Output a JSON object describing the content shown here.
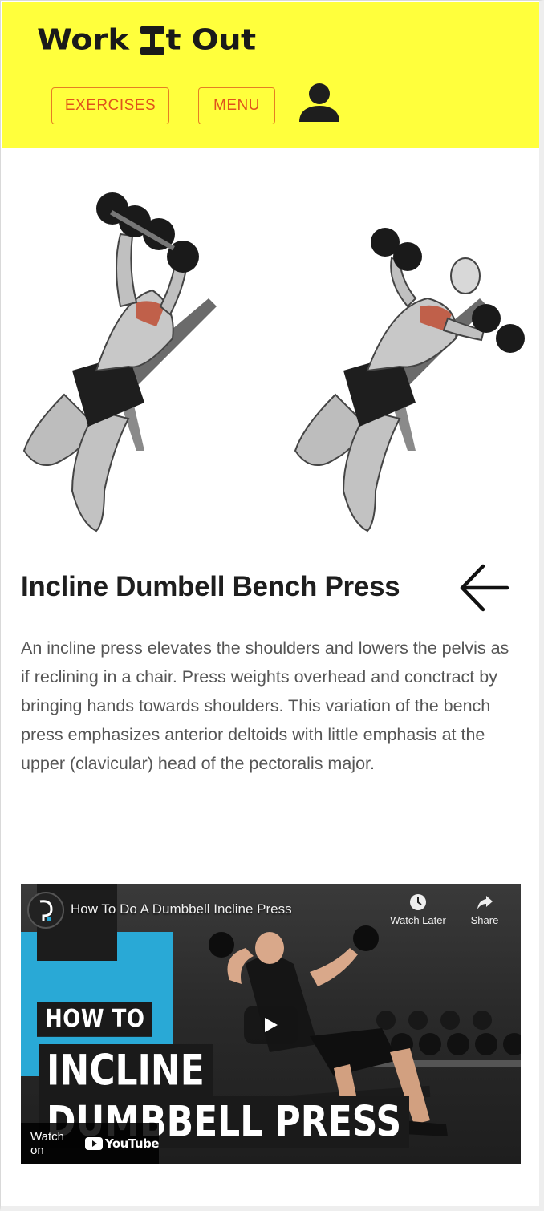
{
  "header": {
    "logo_word_1": "Work",
    "logo_word_2": "t Out",
    "nav": {
      "exercises_label": "EXERCISES",
      "menu_label": "MENU"
    },
    "colors": {
      "background": "#ffff3c",
      "button_text": "#e0531b",
      "button_border": "#e67e22"
    }
  },
  "exercise": {
    "title": "Incline Dumbell Bench Press",
    "description": "An incline press elevates the shoulders and lowers the pelvis as if reclining in a chair. Press weights overhead and conctract by bringing hands towards shoulders. This variation of the bench press emphasizes anterior deltoids with little emphasis at the upper (clavicular) head of the pectoralis major."
  },
  "video": {
    "title": "How To Do A Dumbbell Incline Press",
    "watch_later_label": "Watch Later",
    "share_label": "Share",
    "overlay_line_1": "HOW TO",
    "overlay_line_2": "INCLINE",
    "overlay_line_3": "DUMBBELL PRESS",
    "watch_on_label": "Watch on",
    "youtube_label": "YouTube"
  },
  "icons": {
    "user": "user-icon",
    "back": "arrow-left-icon",
    "play": "play-icon",
    "clock": "clock-icon",
    "share": "share-icon"
  }
}
